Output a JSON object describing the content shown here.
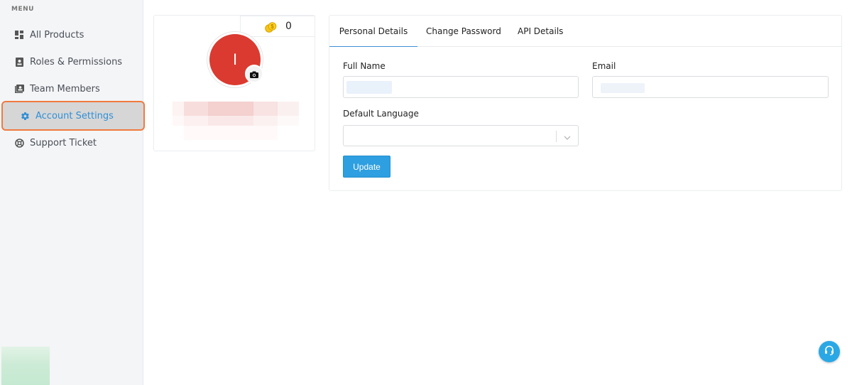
{
  "sidebar": {
    "menu_label": "MENU",
    "items": [
      {
        "label": "All Products",
        "icon": "grid-icon"
      },
      {
        "label": "Roles & Permissions",
        "icon": "id-badge-icon"
      },
      {
        "label": "Team Members",
        "icon": "contacts-icon"
      },
      {
        "label": "Account Settings",
        "icon": "gear-icon",
        "active": true
      },
      {
        "label": "Support Ticket",
        "icon": "lifebuoy-icon"
      }
    ]
  },
  "profile": {
    "credits": "0",
    "avatar_initial": "I",
    "avatar_color": "#db3a30"
  },
  "tabs": [
    "Personal Details",
    "Change Password",
    "API Details"
  ],
  "form": {
    "full_name_label": "Full Name",
    "email_label": "Email",
    "default_language_label": "Default Language",
    "full_name_value": "",
    "email_value": "",
    "default_language_value": "",
    "update_label": "Update"
  },
  "colors": {
    "accent": "#2e9fe0",
    "active_text": "#2f8fd6",
    "active_outline": "#f07a3f"
  }
}
